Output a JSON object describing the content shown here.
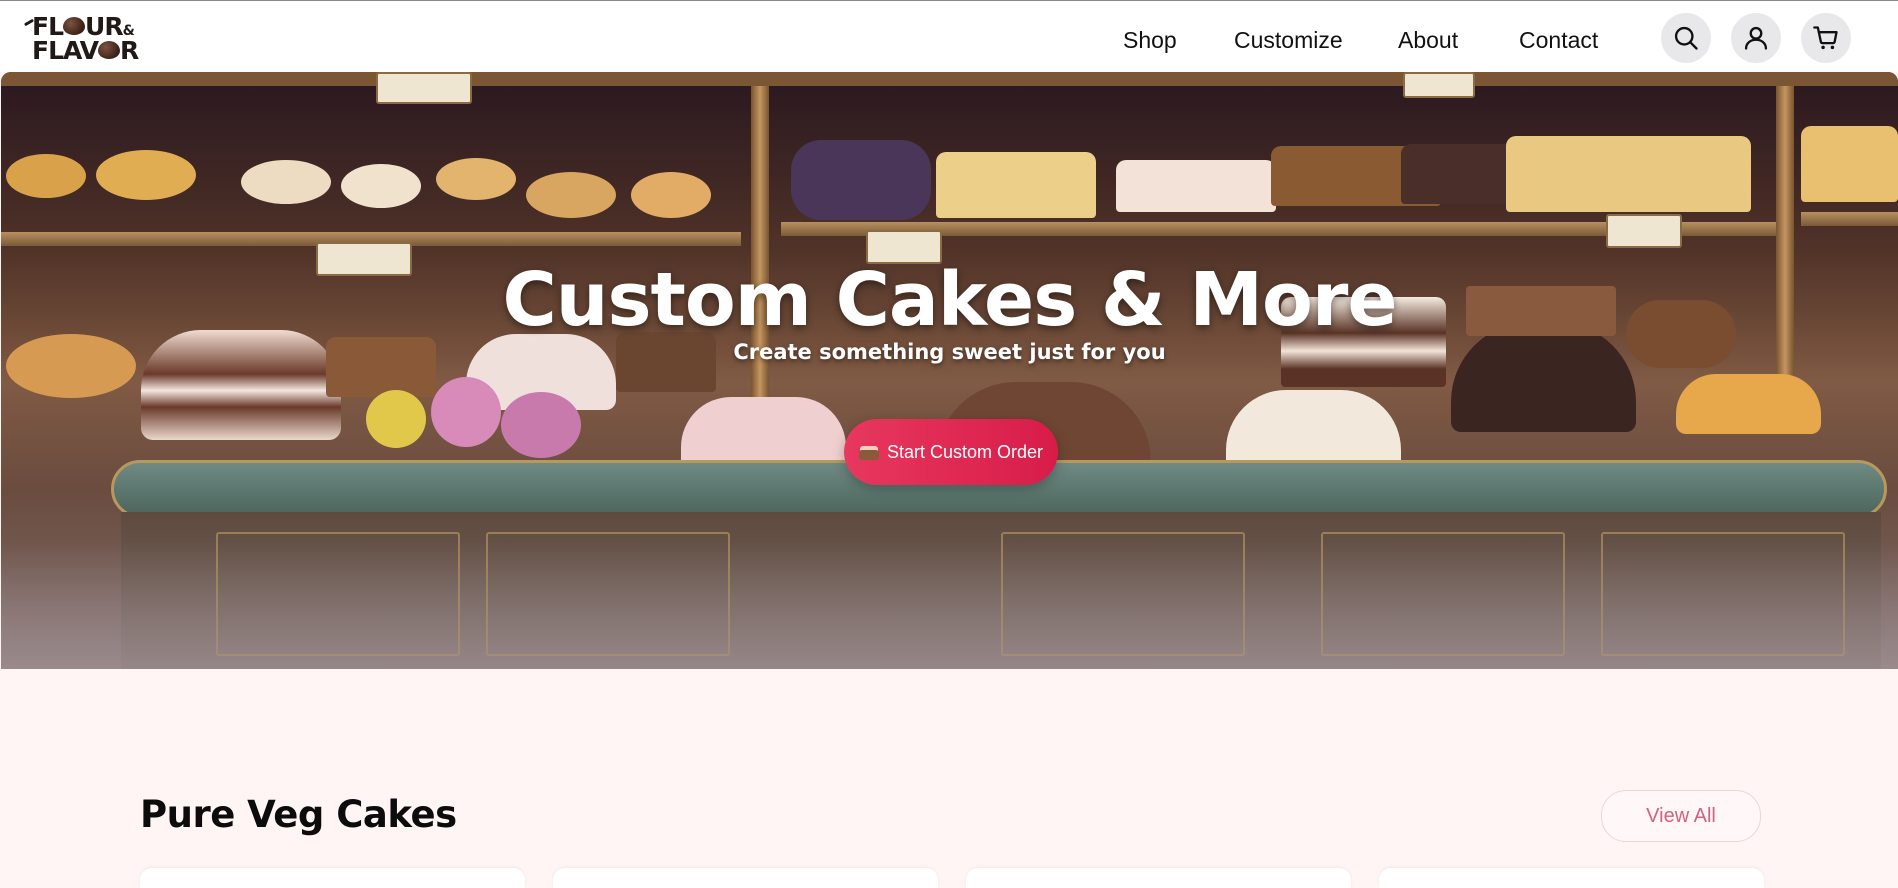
{
  "header": {
    "logo": {
      "line1": "FL",
      "line1b": "UR",
      "amp": "&",
      "line2a": "FLAV",
      "line2b": "R"
    },
    "nav": [
      {
        "label": "Shop"
      },
      {
        "label": "Customize"
      },
      {
        "label": "About"
      },
      {
        "label": "Contact"
      }
    ],
    "icons": [
      "search-icon",
      "user-icon",
      "cart-icon"
    ]
  },
  "hero": {
    "title": "Custom Cakes & More",
    "subtitle": "Create something sweet just for you",
    "cta_label": "Start Custom Order",
    "cta_icon": "cake-icon"
  },
  "section": {
    "title": "Pure Veg Cakes",
    "view_all_label": "View All"
  },
  "colors": {
    "accent": "#e3265a",
    "page_bg": "#fff5f5",
    "view_all_text": "#d4617e"
  }
}
